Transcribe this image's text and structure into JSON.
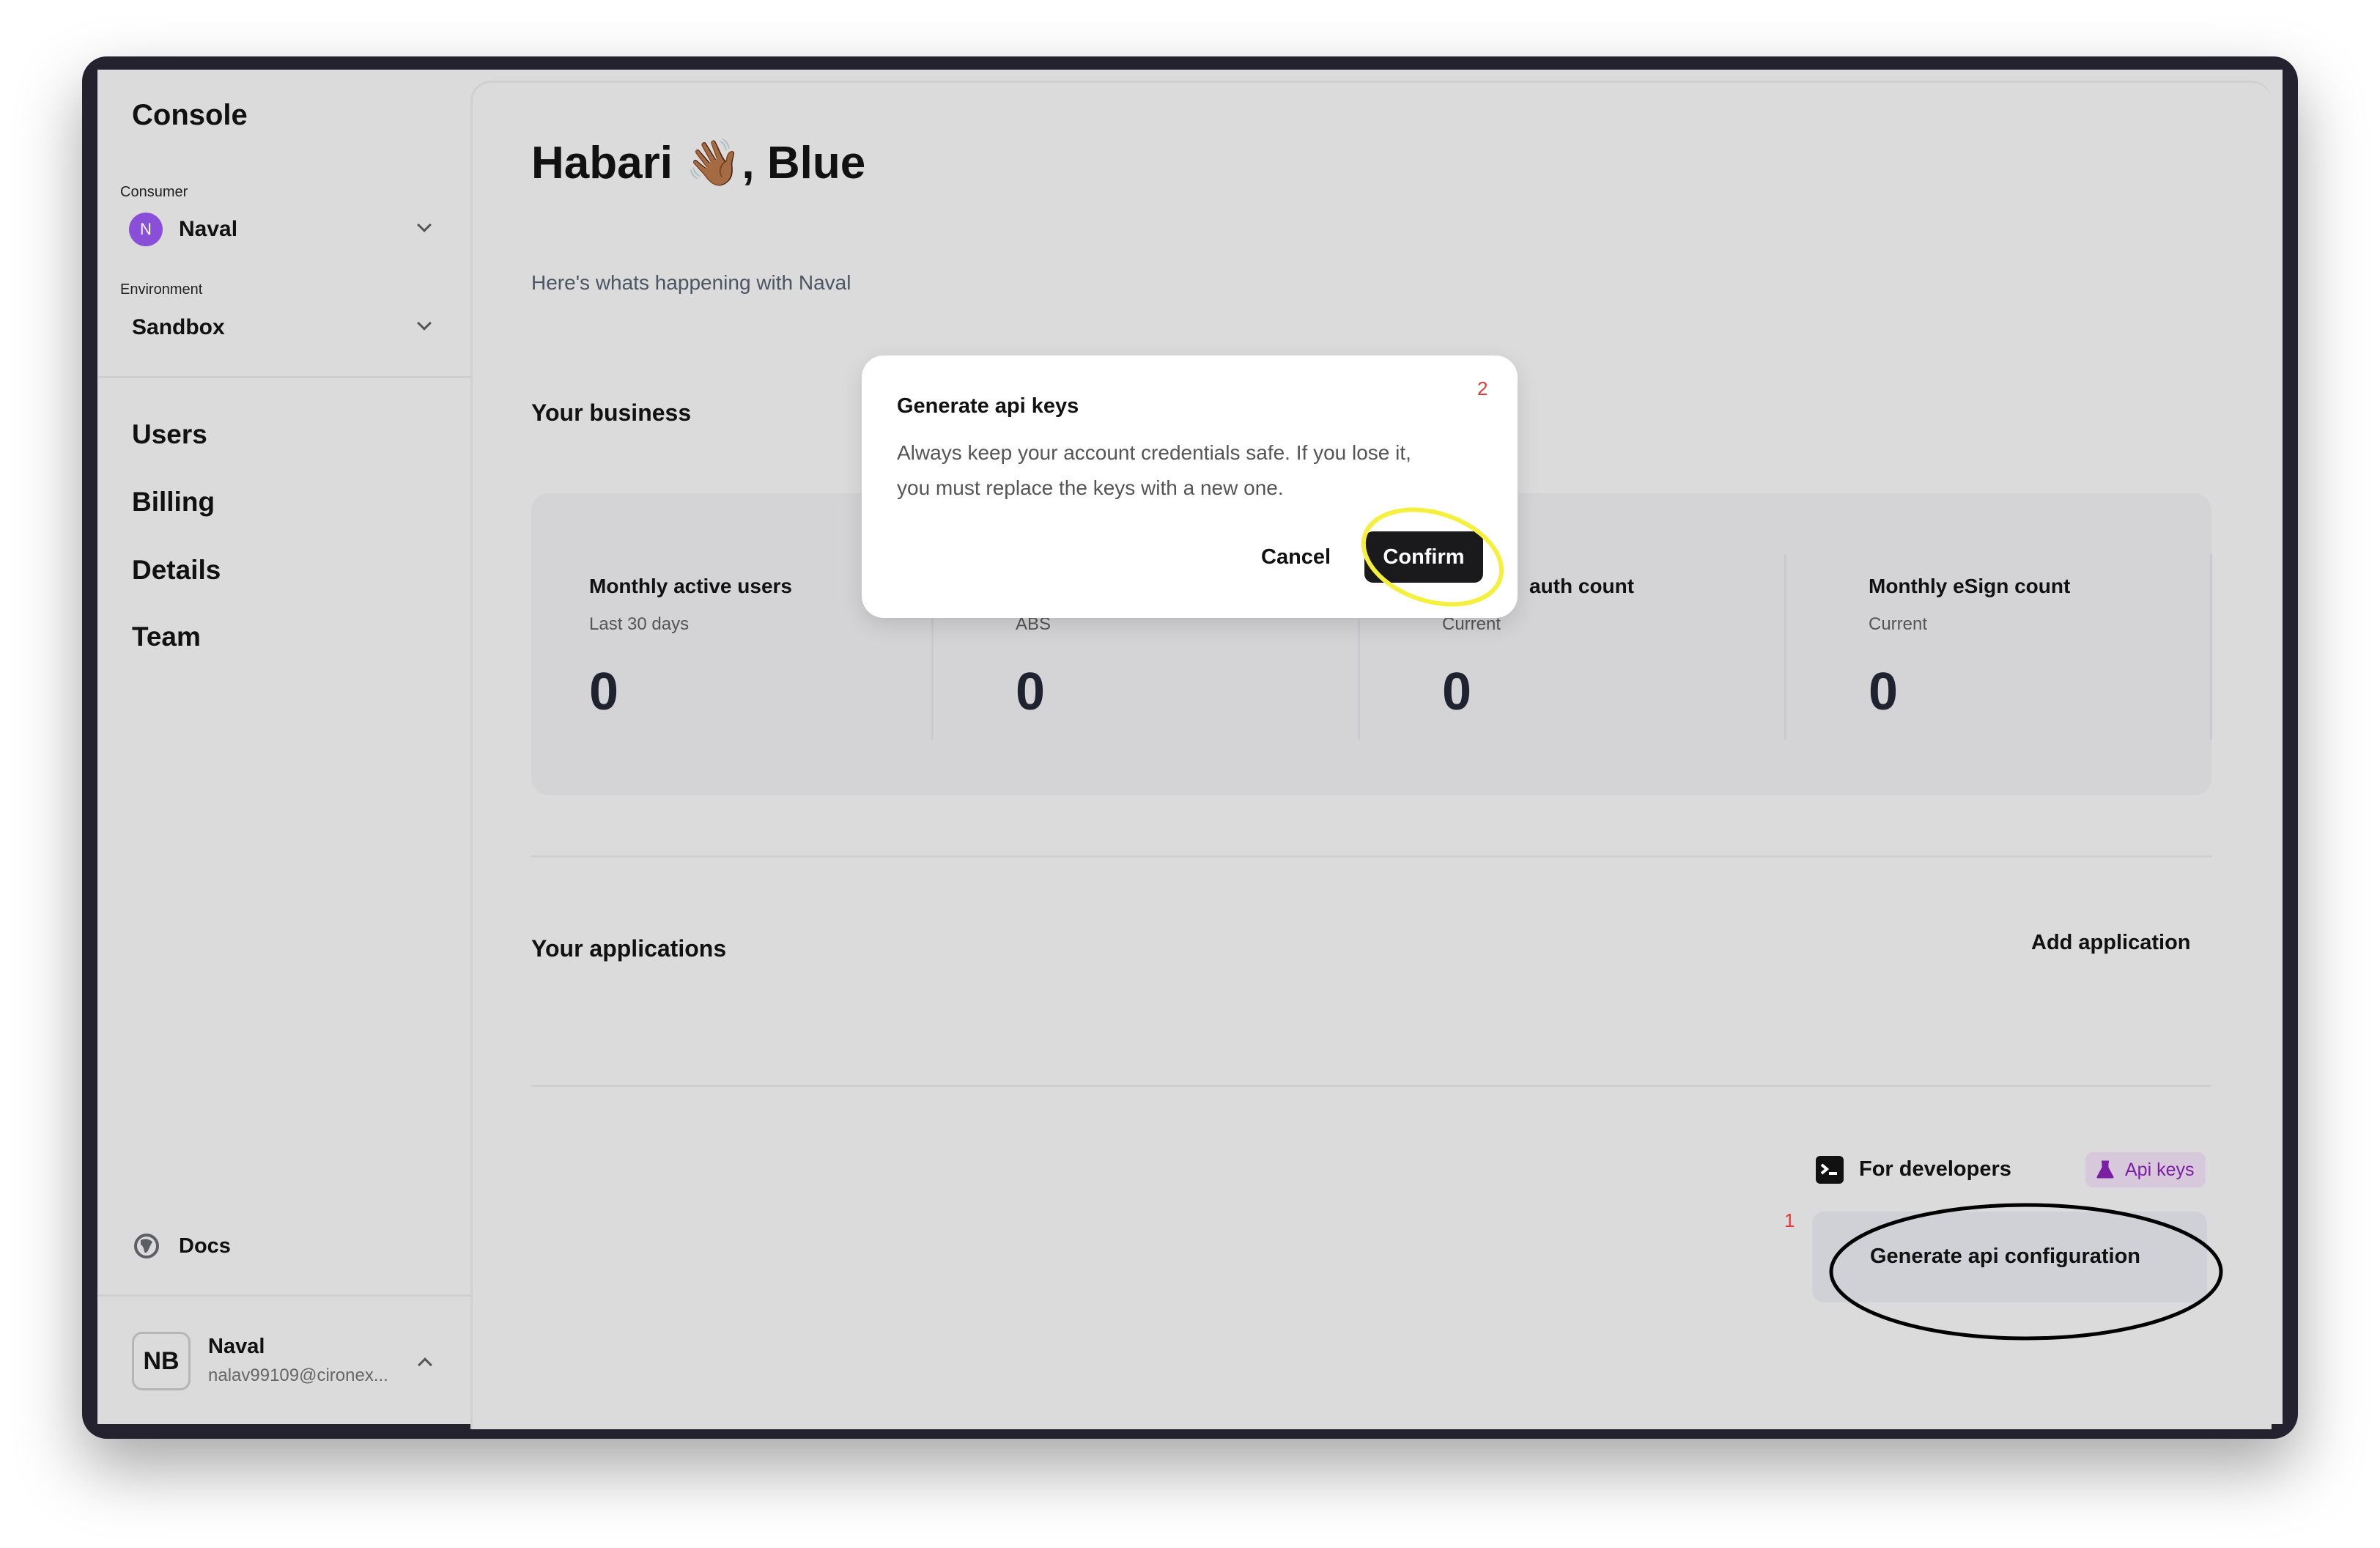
{
  "sidebar": {
    "title": "Console",
    "consumer_label": "Consumer",
    "consumer": {
      "initial": "N",
      "name": "Naval",
      "avatar_color": "#8a4fd8"
    },
    "environment_label": "Environment",
    "environment": "Sandbox",
    "nav": [
      "Users",
      "Billing",
      "Details",
      "Team"
    ],
    "docs": "Docs",
    "user": {
      "initials": "NB",
      "name": "Naval",
      "email": "nalav99109@cironex..."
    }
  },
  "main": {
    "greeting": "Habari 👋🏾, Blue",
    "subtitle": "Here's whats happening with Naval",
    "business_title": "Your business",
    "stats": [
      {
        "title": "Monthly active users",
        "sub": "Last 30 days",
        "value": "0"
      },
      {
        "title": "",
        "sub": "ABS",
        "value": "0"
      },
      {
        "title": "auth count",
        "sub": "Current",
        "value": "0"
      },
      {
        "title": "Monthly eSign count",
        "sub": "Current",
        "value": "0"
      }
    ],
    "applications_title": "Your applications",
    "add_application": "Add application",
    "developers": {
      "title": "For developers",
      "badge": "Api keys",
      "badge_color": "#7b1fa2",
      "step_marker": "1",
      "generate_button": "Generate api configuration"
    }
  },
  "modal": {
    "title": "Generate api keys",
    "step_marker": "2",
    "body_line1": "Always keep your account credentials safe. If you lose it,",
    "body_line2": "you must replace the keys with a new one.",
    "cancel": "Cancel",
    "confirm": "Confirm"
  }
}
